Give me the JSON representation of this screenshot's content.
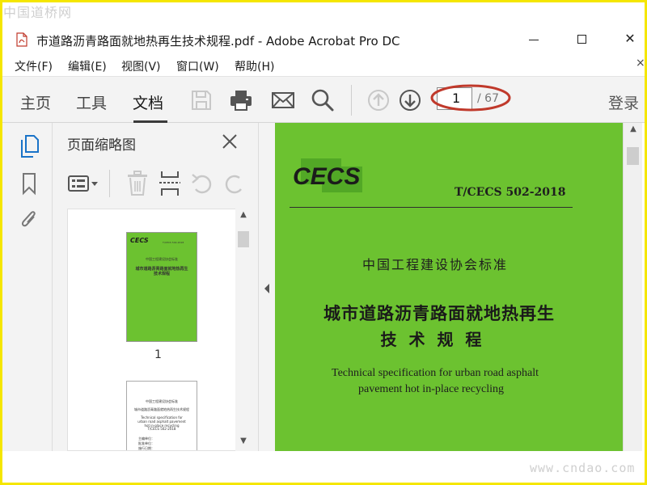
{
  "watermark": {
    "top_left": "中国道桥网",
    "bottom_right": "www.cndao.com"
  },
  "window": {
    "title": "市道路沥青路面就地热再生技术规程.pdf - Adobe Acrobat Pro DC",
    "minimize_icon": "minimize-icon",
    "maximize_icon": "maximize-icon",
    "close_icon": "close-icon",
    "close_glyph": "✕"
  },
  "menu": {
    "items": [
      "文件(F)",
      "编辑(E)",
      "视图(V)",
      "窗口(W)",
      "帮助(H)"
    ],
    "close_glyph": "×"
  },
  "toolbar": {
    "tabs": [
      "主页",
      "工具",
      "文档"
    ],
    "active_tab": "文档",
    "icons": [
      "save-icon",
      "print-icon",
      "email-icon",
      "search-icon",
      "prev-page-icon",
      "next-page-icon"
    ],
    "current_page": "1",
    "page_total": "/ 67",
    "login": "登录"
  },
  "left_rail": {
    "icons": [
      "page-thumbnails-icon",
      "bookmark-icon",
      "attachment-icon"
    ]
  },
  "thumbnail_panel": {
    "title": "页面缩略图",
    "tools": [
      "page-options-icon",
      "delete-icon",
      "insert-page-icon",
      "undo-icon",
      "redo-icon"
    ],
    "page1_number": "1",
    "page1_mini": {
      "logo": "CECS",
      "code": "T/CECS 502-2018",
      "assoc": "中国工程建设协会标准",
      "title": "城市道路沥青路面就地热再生技术规程"
    },
    "page2_mini_lines": [
      "中国工程建设协会标准",
      "城市道路沥青路面就地热再生技术规程",
      "Technical specification for urban road asphalt pavement hot in-place recycling",
      "T/CECS 502-2018",
      "主编单位：",
      "批准单位：",
      "施行日期："
    ]
  },
  "document": {
    "logo_text": "CECS",
    "standard_code": "T/CECS 502-2018",
    "association_standard": "中国工程建设协会标准",
    "title_line1": "城市道路沥青路面就地热再生",
    "title_line2": "技 术 规 程",
    "english_line1": "Technical specification for urban road asphalt",
    "english_line2": "pavement hot in-place recycling"
  },
  "colors": {
    "cover_green": "#6cc230",
    "frame_yellow": "#f5e600",
    "highlight_ellipse": "#c0392b",
    "toolbar_bg": "#f3f3f3",
    "icon_disabled": "#c8c8c8",
    "icon_active": "#555555"
  }
}
